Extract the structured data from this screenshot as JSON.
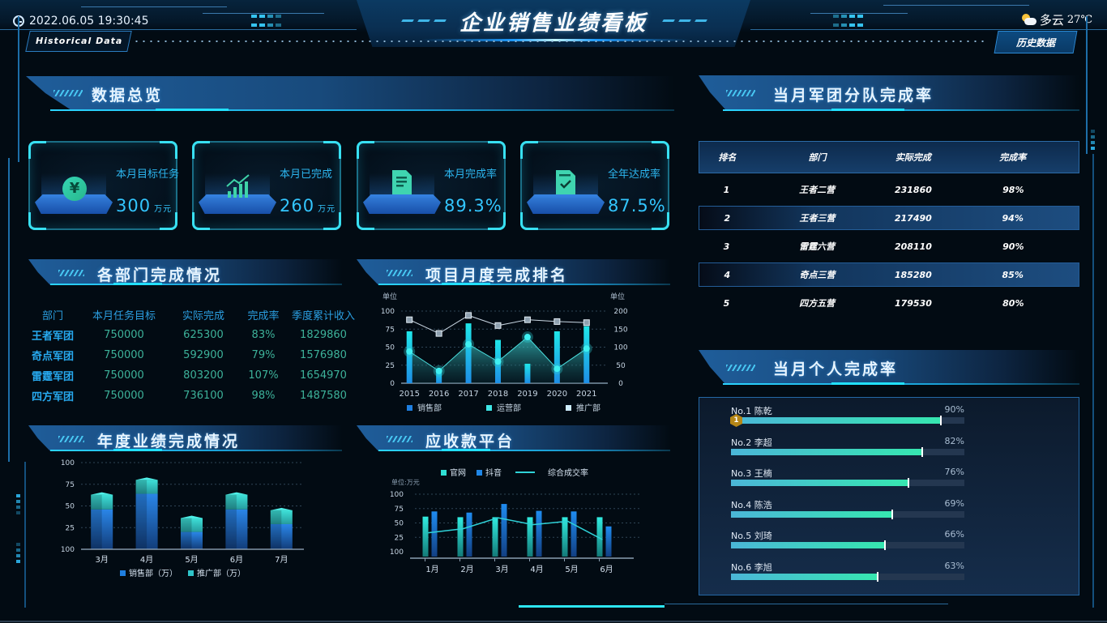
{
  "header": {
    "title": "企业销售业绩看板",
    "datetime": "2022.06.05 19:30:45",
    "historical_tag": "Historical Data",
    "weather_text": "多云",
    "temperature": "27℃",
    "history_button": "历史数据"
  },
  "sections": {
    "overview": "数据总览",
    "dept": "各部门完成情况",
    "rank_chart": "项目月度完成排名",
    "annual": "年度业绩完成情况",
    "receivable": "应收款平台",
    "team_rate": "当月军团分队完成率",
    "personal": "当月个人完成率"
  },
  "kpis": [
    {
      "label": "本月目标任务",
      "value": "300",
      "unit": "万元",
      "icon": "yen-icon"
    },
    {
      "label": "本月已完成",
      "value": "260",
      "unit": "万元",
      "icon": "growth-chart-icon"
    },
    {
      "label": "本月完成率",
      "value": "89.3%",
      "unit": "",
      "icon": "document-icon"
    },
    {
      "label": "全年达成率",
      "value": "87.5%",
      "unit": "",
      "icon": "checklist-icon"
    }
  ],
  "dept_table": {
    "headers": [
      "部门",
      "本月任务目标",
      "实际完成",
      "完成率",
      "季度累计收入"
    ],
    "rows": [
      [
        "王者军团",
        "750000",
        "625300",
        "83%",
        "1829860"
      ],
      [
        "奇点军团",
        "750000",
        "592900",
        "79%",
        "1576980"
      ],
      [
        "雷霆军团",
        "750000",
        "803200",
        "107%",
        "1654970"
      ],
      [
        "四方军团",
        "750000",
        "736100",
        "98%",
        "1487580"
      ]
    ]
  },
  "rank_table": {
    "headers": [
      "排名",
      "部门",
      "实际完成",
      "完成率"
    ],
    "rows": [
      [
        "1",
        "王者二营",
        "231860",
        "98%"
      ],
      [
        "2",
        "王者三营",
        "217490",
        "94%"
      ],
      [
        "3",
        "雷霆六营",
        "208110",
        "90%"
      ],
      [
        "4",
        "奇点三营",
        "185280",
        "85%"
      ],
      [
        "5",
        "四方五营",
        "179530",
        "80%"
      ]
    ]
  },
  "personal": [
    {
      "label": "No.1  陈乾",
      "pct_text": "90%",
      "pct": 90,
      "medal": "1"
    },
    {
      "label": "No.2  李超",
      "pct_text": "82%",
      "pct": 82
    },
    {
      "label": "No.3  王楠",
      "pct_text": "76%",
      "pct": 76
    },
    {
      "label": "No.4  陈浩",
      "pct_text": "69%",
      "pct": 69
    },
    {
      "label": "No.5  刘琦",
      "pct_text": "66%",
      "pct": 66
    },
    {
      "label": "No.6  李旭",
      "pct_text": "63%",
      "pct": 63
    }
  ],
  "chart_data": [
    {
      "id": "rank_chart",
      "type": "bar",
      "title": "项目月度完成排名",
      "categories": [
        "2015",
        "2016",
        "2017",
        "2018",
        "2019",
        "2020",
        "2021"
      ],
      "ylabel_left": "单位",
      "ylabel_right": "单位",
      "ylim_left": [
        0,
        100
      ],
      "ylim_right": [
        0,
        200
      ],
      "yticks_left": [
        "0",
        "25",
        "50",
        "75",
        "100"
      ],
      "yticks_right": [
        "0",
        "50",
        "100",
        "150",
        "200"
      ],
      "series": [
        {
          "name": "销售部",
          "kind": "bar",
          "axis": "left",
          "values": [
            72,
            20,
            83,
            60,
            27,
            72,
            79
          ],
          "color": "#1f8de6"
        },
        {
          "name": "运营部",
          "kind": "area",
          "axis": "left",
          "values": [
            44,
            17,
            54,
            30,
            64,
            20,
            48
          ],
          "color": "#3fe0e6"
        },
        {
          "name": "推广部",
          "kind": "line",
          "axis": "right",
          "values": [
            176,
            138,
            188,
            160,
            176,
            171,
            168
          ],
          "color": "#c9e3f5"
        }
      ],
      "legend": "bottom",
      "grid": true
    },
    {
      "id": "annual_chart",
      "type": "bar",
      "stacked": true,
      "title": "年度业绩完成情况",
      "categories": [
        "3月",
        "4月",
        "5月",
        "6月",
        "7月"
      ],
      "yticks": [
        "100",
        "25",
        "50",
        "75",
        "100"
      ],
      "ylim": [
        0,
        100
      ],
      "series": [
        {
          "name": "销售部（万）",
          "values": [
            46,
            64,
            20,
            46,
            29
          ],
          "color": "#1f7fe0"
        },
        {
          "name": "推广部（万）",
          "values": [
            17,
            16,
            16,
            17,
            16
          ],
          "color": "#2fc4c9"
        }
      ],
      "legend": "bottom",
      "grid": true
    },
    {
      "id": "receivable_chart",
      "type": "bar",
      "title": "应收款平台",
      "ylabel": "单位:万元",
      "categories": [
        "1月",
        "2月",
        "3月",
        "4月",
        "5月",
        "6月"
      ],
      "yticks": [
        "100",
        "25",
        "50",
        "75",
        "100"
      ],
      "ylim": [
        0,
        100
      ],
      "series": [
        {
          "name": "官网",
          "kind": "bar",
          "values": [
            61,
            60,
            60,
            60,
            60,
            60
          ],
          "color": "#2fe0d4"
        },
        {
          "name": "抖音",
          "kind": "bar",
          "values": [
            70,
            68,
            83,
            71,
            70,
            44
          ],
          "color": "#1f86e6"
        },
        {
          "name": "综合成交率",
          "kind": "line",
          "values": [
            33,
            40,
            59,
            47,
            53,
            21
          ],
          "color": "#2fd2d8"
        }
      ],
      "legend": "top",
      "grid": true
    }
  ]
}
